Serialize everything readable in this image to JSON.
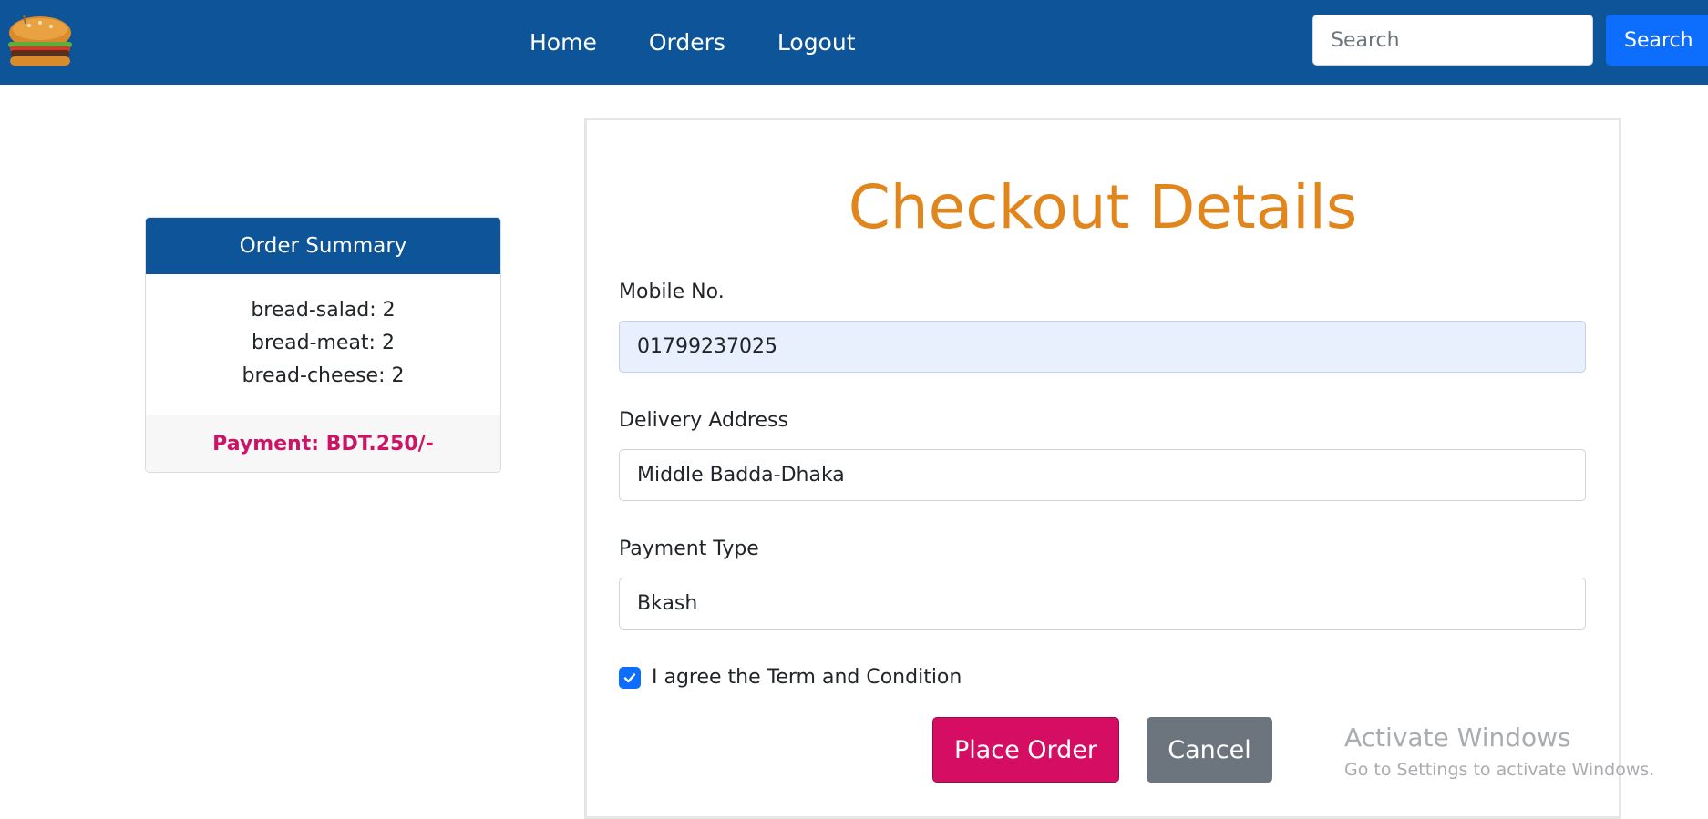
{
  "navbar": {
    "logo_icon": "burger-icon",
    "links": [
      "Home",
      "Orders",
      "Logout"
    ],
    "search": {
      "placeholder": "Search",
      "value": "",
      "button_label": "Search"
    },
    "bg_color": "#0d5499"
  },
  "order_summary": {
    "title": "Order Summary",
    "items": [
      "bread-salad: 2",
      "bread-meat: 2",
      "bread-cheese: 2"
    ],
    "payment_label": "Payment: BDT.250/-",
    "accent_color": "#cc1466"
  },
  "checkout": {
    "title": "Checkout Details",
    "title_color": "#e0861c",
    "fields": [
      {
        "label": "Mobile No.",
        "value": "01799237025"
      },
      {
        "label": "Delivery Address",
        "value": "Middle Badda-Dhaka"
      },
      {
        "label": "Payment Type",
        "value": "Bkash"
      }
    ],
    "agree_checked": true,
    "agree_label": "I agree the Term and Condition",
    "place_order_label": "Place Order",
    "cancel_label": "Cancel"
  },
  "watermark": {
    "title": "Activate Windows",
    "subtitle": "Go to Settings to activate Windows."
  }
}
